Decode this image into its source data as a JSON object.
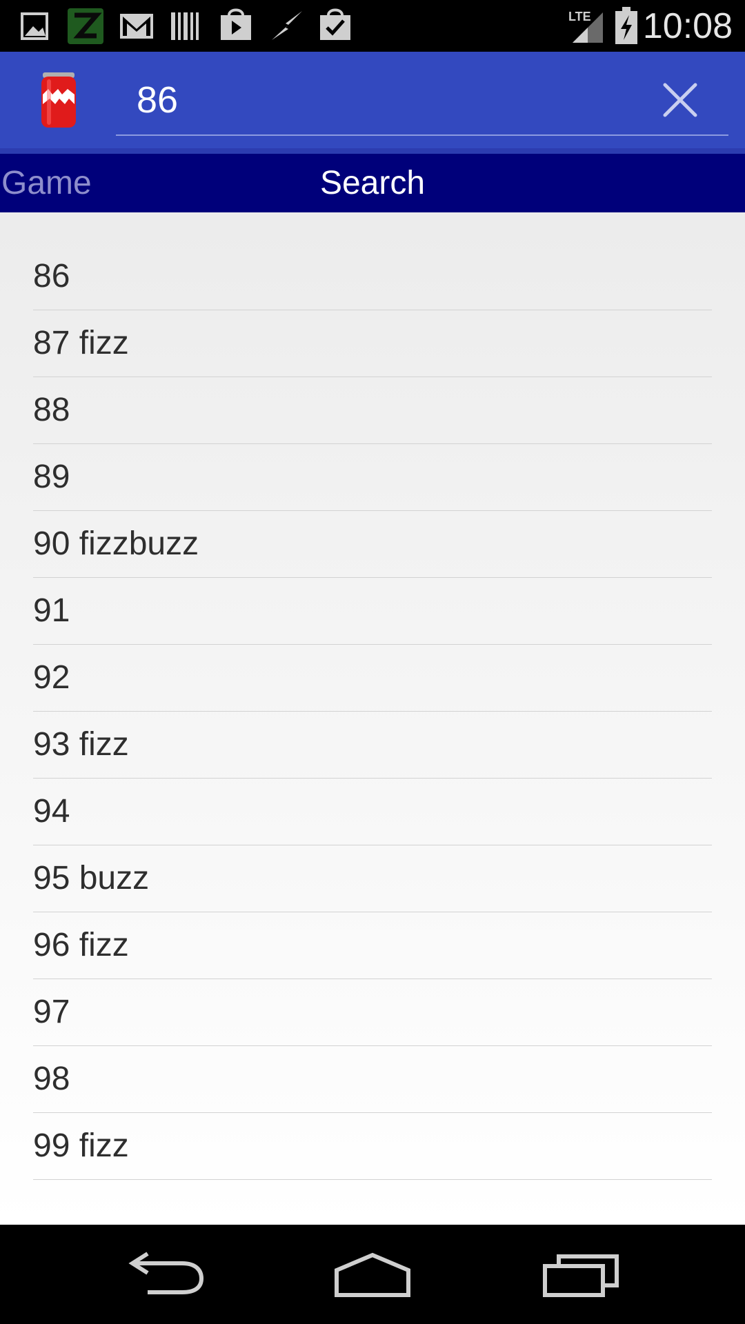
{
  "status_bar": {
    "icons": [
      "gallery-icon",
      "z-app-icon",
      "gmail-icon",
      "barcode-icon",
      "play-store-icon",
      "flash-icon",
      "task-check-icon",
      "lte-signal-icon",
      "battery-charging-icon"
    ],
    "network": "LTE",
    "time": "10:08"
  },
  "action_bar": {
    "app_icon": "soda-can-icon",
    "search_value": "86",
    "clear_icon": "close-icon",
    "color": "#3349bf"
  },
  "tabs": [
    {
      "label": "Game",
      "active": false
    },
    {
      "label": "Search",
      "active": true
    }
  ],
  "results": [
    "86",
    "87 fizz",
    "88",
    "89",
    "90 fizzbuzz",
    "91",
    "92",
    "93 fizz",
    "94",
    "95 buzz",
    "96 fizz",
    "97",
    "98",
    "99 fizz"
  ],
  "nav_bar": {
    "buttons": [
      "back-icon",
      "home-icon",
      "recents-icon"
    ]
  },
  "colors": {
    "tab_strip": "#00007a",
    "tab_inactive": "#8e8ecc",
    "list_text": "#2e2e2e"
  }
}
